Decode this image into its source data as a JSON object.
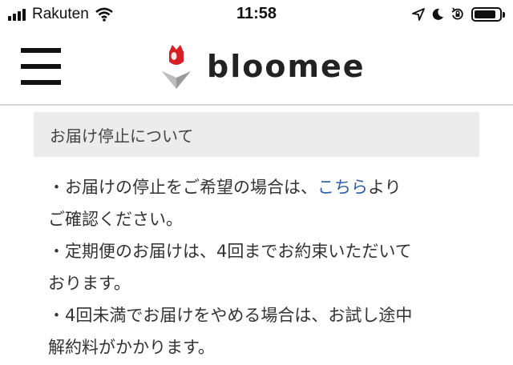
{
  "status_bar": {
    "carrier": "Rakuten",
    "time": "11:58",
    "battery_level": 0.85,
    "icons": [
      "signal-icon",
      "wifi-icon",
      "location-icon",
      "moon-icon",
      "rotation-lock-icon",
      "battery-icon"
    ]
  },
  "header": {
    "menu_icon": "hamburger-icon",
    "logo_text": "bloomee",
    "brand_color": "#d81f26"
  },
  "section": {
    "title": "お届け停止について"
  },
  "notice": {
    "line1_prefix": "・お届けの停止をご希望の場合は、",
    "line1_link": "こちら",
    "line1_suffix": "より",
    "line2": "ご確認ください。",
    "line3": "・定期便のお届けは、4回までお約束いただいて",
    "line4": "おります。",
    "line5": "・4回未満でお届けをやめる場合は、お試し途中",
    "line6": "解約料がかかります。"
  }
}
